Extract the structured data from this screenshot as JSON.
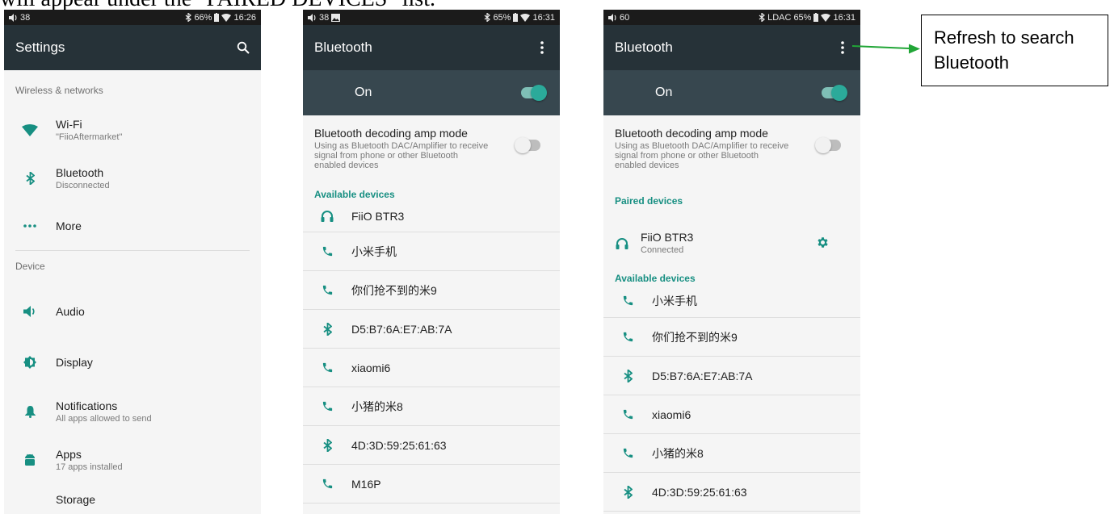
{
  "caption": "will appear under the \"PAIRED DEVICES\" list.",
  "colors": {
    "appbar": "#263238",
    "switchbar": "#37474f",
    "accent": "#178f82",
    "toggle_on": "#2baa9a",
    "arrow": "#21a637"
  },
  "screen1": {
    "status": {
      "volume": "38",
      "battery": "66%",
      "time": "16:26"
    },
    "title": "Settings",
    "action_icon": "search-icon",
    "sections": {
      "wireless": "Wireless & networks",
      "device": "Device"
    },
    "items": [
      {
        "title": "Wi-Fi",
        "summary": "\"FiioAftermarket\"",
        "icon": "wifi-icon"
      },
      {
        "title": "Bluetooth",
        "summary": "Disconnected",
        "icon": "bluetooth-icon"
      },
      {
        "title": "More",
        "summary": "",
        "icon": "more-horiz-icon"
      },
      {
        "title": "Audio",
        "summary": "",
        "icon": "volume-icon"
      },
      {
        "title": "Display",
        "summary": "",
        "icon": "brightness-icon"
      },
      {
        "title": "Notifications",
        "summary": "All apps allowed to send",
        "icon": "bell-icon"
      },
      {
        "title": "Apps",
        "summary": "17 apps installed",
        "icon": "android-icon"
      },
      {
        "title": "Storage",
        "summary": "",
        "icon": "storage-icon"
      }
    ]
  },
  "screen2": {
    "status": {
      "volume": "38",
      "battery": "65%",
      "time": "16:31"
    },
    "title": "Bluetooth",
    "switch_label": "On",
    "amp_title": "Bluetooth decoding amp mode",
    "amp_desc": "Using as Bluetooth DAC/Amplifier to receive signal from phone or other Bluetooth enabled devices",
    "available_header": "Available devices",
    "devices": [
      {
        "name": "FiiO BTR3",
        "icon": "headphones-icon"
      },
      {
        "name": "小米手机",
        "icon": "phone-icon"
      },
      {
        "name": "你们抢不到的米9",
        "icon": "phone-icon"
      },
      {
        "name": "D5:B7:6A:E7:AB:7A",
        "icon": "bluetooth-icon"
      },
      {
        "name": "xiaomi6",
        "icon": "phone-icon"
      },
      {
        "name": "小猪的米8",
        "icon": "phone-icon"
      },
      {
        "name": "4D:3D:59:25:61:63",
        "icon": "bluetooth-icon"
      },
      {
        "name": "M16P",
        "icon": "phone-icon"
      }
    ]
  },
  "screen3": {
    "status": {
      "volume": "60",
      "codec": "LDAC",
      "battery": "65%",
      "time": "16:31"
    },
    "title": "Bluetooth",
    "switch_label": "On",
    "amp_title": "Bluetooth decoding amp mode",
    "amp_desc": "Using as Bluetooth DAC/Amplifier to receive signal from phone or other Bluetooth enabled devices",
    "paired_header": "Paired devices",
    "paired": {
      "name": "FiiO BTR3",
      "status": "Connected",
      "icon": "headphones-icon"
    },
    "available_header": "Available devices",
    "devices": [
      {
        "name": "小米手机",
        "icon": "phone-icon"
      },
      {
        "name": "你们抢不到的米9",
        "icon": "phone-icon"
      },
      {
        "name": "D5:B7:6A:E7:AB:7A",
        "icon": "bluetooth-icon"
      },
      {
        "name": "xiaomi6",
        "icon": "phone-icon"
      },
      {
        "name": "小猪的米8",
        "icon": "phone-icon"
      },
      {
        "name": "4D:3D:59:25:61:63",
        "icon": "bluetooth-icon"
      }
    ]
  },
  "callout": {
    "text": "Refresh to search Bluetooth"
  }
}
